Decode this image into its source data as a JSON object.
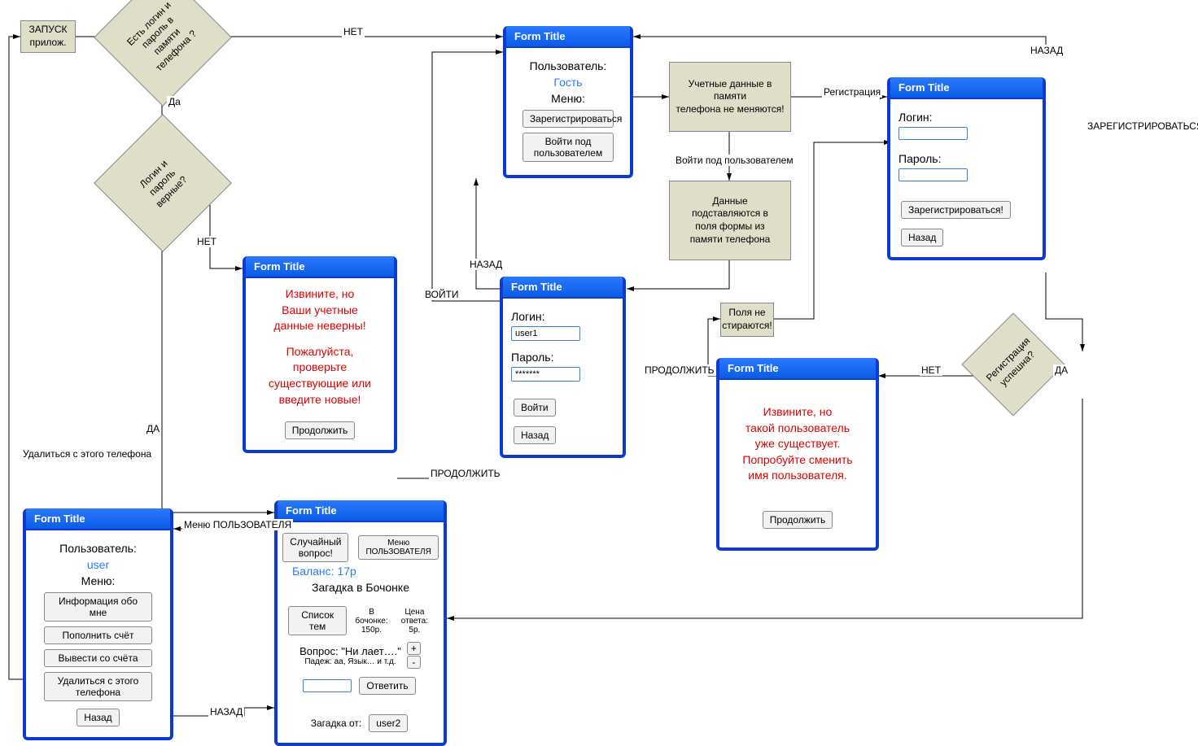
{
  "start": {
    "label": "ЗАПУСК\nприлож."
  },
  "d1": {
    "label": "Есть логин и\nпароль в\nпамяти\nтелефона ?"
  },
  "d2": {
    "label": "Логин и\nпароль\nверные?"
  },
  "d3": {
    "label": "Регистрация\nуспешна?"
  },
  "p_nochange": {
    "label": "Учетные данные в памяти\nтелефона не меняются!"
  },
  "p_fill": {
    "label": "Данные\nподставляются в\nполя формы из\nпамяти телефона"
  },
  "p_nonerase": {
    "label": "Поля не\nстираются!"
  },
  "edge": {
    "no": "НЕТ",
    "yes_da": "Да",
    "da_caps": "ДА",
    "back": "НАЗАД",
    "reg": "Регистрация",
    "login_as": "Войти под пользователем",
    "zareg": "ЗАРЕГИСТРИРОВАТЬСЯ",
    "vojti": "ВОЙТИ",
    "continue": "ПРОДОЛЖИТЬ",
    "delete_phone": "Удалиться с этого телефона",
    "user_menu": "Меню ПОЛЬЗОВАТЕЛЯ",
    "back_lower": "НАЗАД"
  },
  "form_guest": {
    "title": "Form Title",
    "user_label": "Пользователь:",
    "user_value": "Гость",
    "menu_label": "Меню:",
    "btn_reg": "Зарегистрироваться",
    "btn_login": "Войти под пользователем"
  },
  "form_reg": {
    "title": "Form Title",
    "login_label": "Логин:",
    "login_value": "",
    "password_label": "Пароль:",
    "password_value": "",
    "btn_reg": "Зарегистрироваться!",
    "btn_back": "Назад"
  },
  "form_login": {
    "title": "Form Title",
    "login_label": "Логин:",
    "login_value": "user1",
    "password_label": "Пароль:",
    "password_value": "*******",
    "btn_login": "Войти",
    "btn_back": "Назад"
  },
  "form_error_login": {
    "title": "Form Title",
    "line1": "Извините, но\nВаши учетные\nданные неверны!",
    "line2": "Пожалуйста,\nпроверьте\nсуществующие или\nвведите новые!",
    "btn_continue": "Продолжить"
  },
  "form_error_reg": {
    "title": "Form Title",
    "text": "Извините, но\nтакой пользователь\nуже существует.\nПопробуйте сменить\nимя пользователя.",
    "btn_continue": "Продолжить"
  },
  "form_user": {
    "title": "Form Title",
    "user_label": "Пользователь:",
    "user_value": "user",
    "menu_label": "Меню:",
    "btn_info": "Информация обо мне",
    "btn_topup": "Пополнить счёт",
    "btn_withdraw": "Вывести со счёта",
    "btn_delete": "Удалиться с этого телефона",
    "btn_back": "Назад"
  },
  "form_game": {
    "title": "Form Title",
    "btn_random": "Случайный вопрос!",
    "btn_menu": "Меню\nПОЛЬЗОВАТЕЛЯ",
    "balance": "Баланс: 17р",
    "heading": "Загадка в Бочонке",
    "btn_topics": "Список тем",
    "barrel_label": "В бочонке:",
    "barrel_value": "150р.",
    "price_label": "Цена ответа:",
    "price_value": "5р.",
    "question": "Вопрос: \"Ни лает….\"",
    "hint": "Падеж: аа, Язык… и т.д.",
    "btn_answer": "Ответить",
    "btn_plus": "+",
    "btn_minus": "-",
    "riddle_from_label": "Загадка от:",
    "riddle_from_value": "user2",
    "answer_input": ""
  }
}
